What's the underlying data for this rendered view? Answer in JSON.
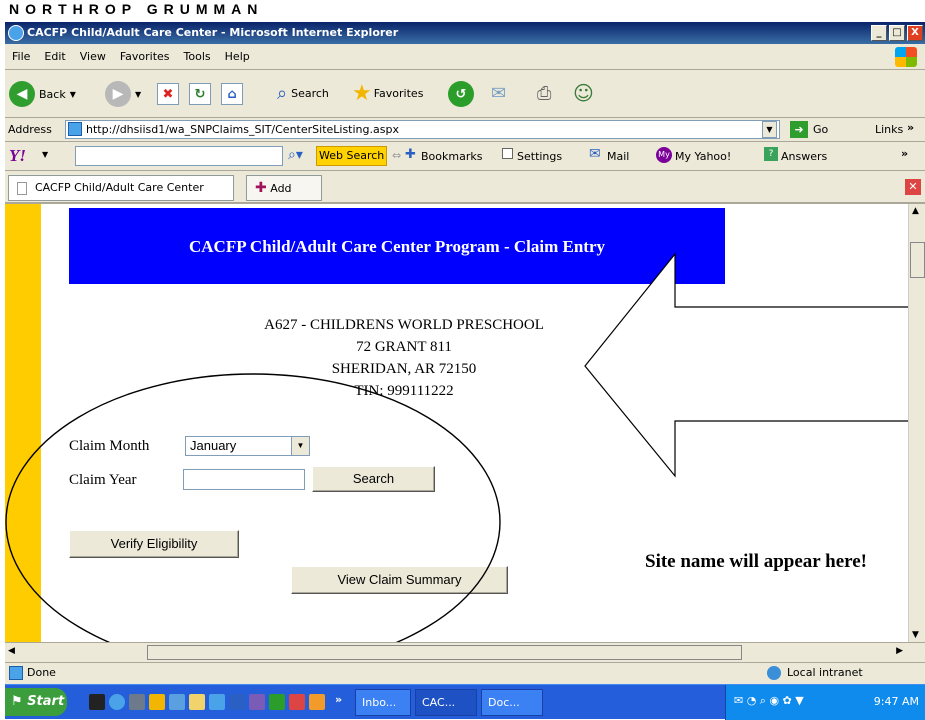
{
  "brand": "NORTHROP GRUMMAN",
  "window": {
    "title": "CACFP Child/Adult Care Center - Microsoft Internet Explorer",
    "min": "_",
    "max": "□",
    "close": "X"
  },
  "menu": [
    "File",
    "Edit",
    "View",
    "Favorites",
    "Tools",
    "Help"
  ],
  "toolbar": {
    "back": "Back",
    "search": "Search",
    "favorites": "Favorites"
  },
  "address": {
    "label": "Address",
    "url": "http://dhsiisd1/wa_SNPClaims_SIT/CenterSiteListing.aspx",
    "go": "Go",
    "links": "Links"
  },
  "yahoo": {
    "logo": "Y!",
    "web_search": "Web Search",
    "bookmarks": "Bookmarks",
    "settings": "Settings",
    "mail": "Mail",
    "my_yahoo": "My Yahoo!",
    "answers": "Answers"
  },
  "tabs": {
    "current": "CACFP Child/Adult Care Center",
    "add": "Add Tab"
  },
  "page": {
    "banner": "CACFP Child/Adult Care Center Program - Claim Entry",
    "site": {
      "line1": "A627 - CHILDRENS WORLD PRESCHOOL",
      "line2": "72 GRANT 811",
      "line3": "SHERIDAN, AR 72150",
      "line4": "TIN: 999111222"
    },
    "claim_month_label": "Claim Month",
    "claim_month_value": "January",
    "claim_year_label": "Claim Year",
    "claim_year_value": "",
    "search_button": "Search",
    "verify_button": "Verify Eligibility",
    "summary_button": "View Claim Summary",
    "callout": "Site name will appear here!"
  },
  "status": {
    "text": "Done",
    "zone": "Local intranet"
  },
  "taskbar": {
    "start": "Start",
    "tasks": [
      "Inbo...",
      "CAC...",
      "Doc..."
    ],
    "clock": "9:47 AM"
  },
  "colors": {
    "banner": "#0000ff",
    "stripe": "#ffcc00",
    "titlebar": "#0a246a"
  }
}
